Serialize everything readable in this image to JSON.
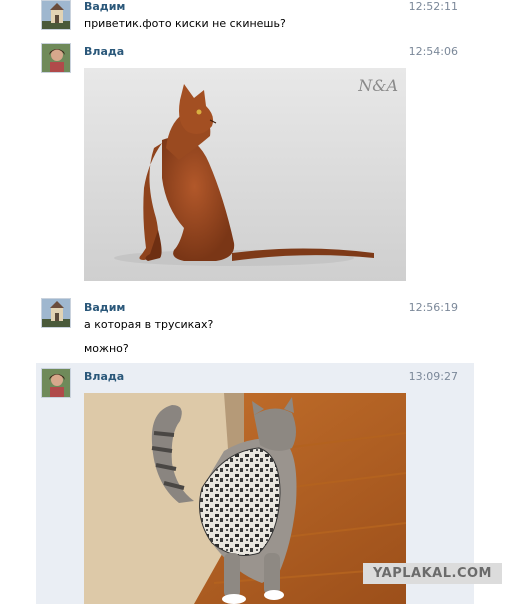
{
  "messages": [
    {
      "author": "Вадим",
      "time": "12:52:11",
      "lines": [
        "приветик.фото киски не скинешь?"
      ]
    },
    {
      "author": "Влада",
      "time": "12:54:06",
      "photo": "abyssinian-cat-photo"
    },
    {
      "author": "Вадим",
      "time": "12:56:19",
      "lines": [
        "а которая в трусиках?",
        "можно?"
      ]
    },
    {
      "author": "Влада",
      "time": "13:09:27",
      "photo": "cat-in-underwear-photo"
    }
  ],
  "watermark": "YAPLAKAL.COM",
  "photo_mark": "N&A",
  "colors": {
    "author": "#2b587a",
    "highlight": "#eaeef4"
  }
}
